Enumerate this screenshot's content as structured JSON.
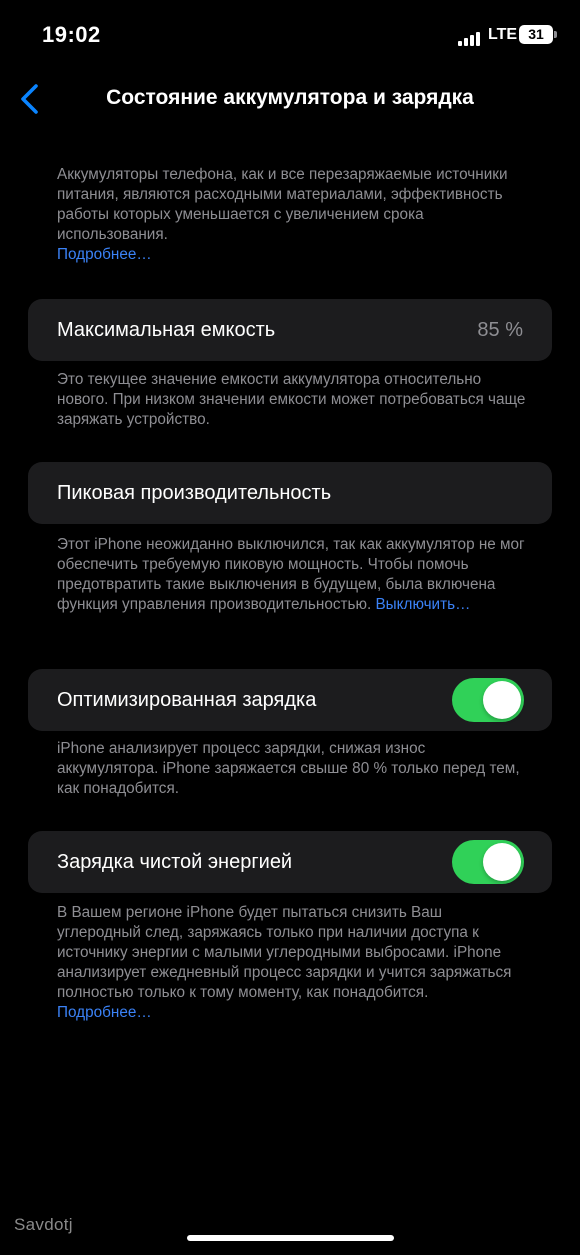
{
  "status_bar": {
    "time": "19:02",
    "network": "LTE",
    "battery_level": "31"
  },
  "nav": {
    "back_icon": "chevron-left-icon",
    "title": "Состояние аккумулятора и зарядка",
    "accent_color": "#0a84ff"
  },
  "intro": {
    "text": "Аккумуляторы телефона, как и все перезаряжаемые источники питания, являются расходными материалами, эффективность работы которых уменьшается с увеличением срока использования.",
    "link": "Подробнее…"
  },
  "max_capacity": {
    "label": "Максимальная емкость",
    "value": "85 %",
    "note": "Это текущее значение емкости аккумулятора относительно нового. При низком значении емкости может потребоваться чаще заряжать устройство."
  },
  "peak_performance": {
    "label": "Пиковая производительность",
    "note": "Этот iPhone неожиданно выключился, так как аккумулятор не мог обеспечить требуемую пиковую мощность. Чтобы помочь предотвратить такие выключения в будущем, была включена функция управления производительностью.",
    "link": "Выключить…"
  },
  "optimized_charging": {
    "label": "Оптимизированная зарядка",
    "enabled": true,
    "note": "iPhone анализирует процесс зарядки, снижая износ аккумулятора. iPhone заряжается свыше 80 % только перед тем, как понадобится."
  },
  "clean_energy": {
    "label": "Зарядка чистой энергией",
    "enabled": true,
    "note": "В Вашем регионе iPhone будет пытаться снизить Ваш углеродный след, заряжаясь только при наличии доступа к источнику энергии с малыми углеродными выбросами. iPhone анализирует ежедневный процесс зарядки и учится заряжаться полностью только к тому моменту, как понадобится.",
    "link": "Подробнее…"
  },
  "watermark": "Savdotj",
  "colors": {
    "toggle_on": "#30d158",
    "cell_background": "#1c1c1e",
    "secondary_text": "#8e8e93",
    "link": "#3b82f6"
  }
}
